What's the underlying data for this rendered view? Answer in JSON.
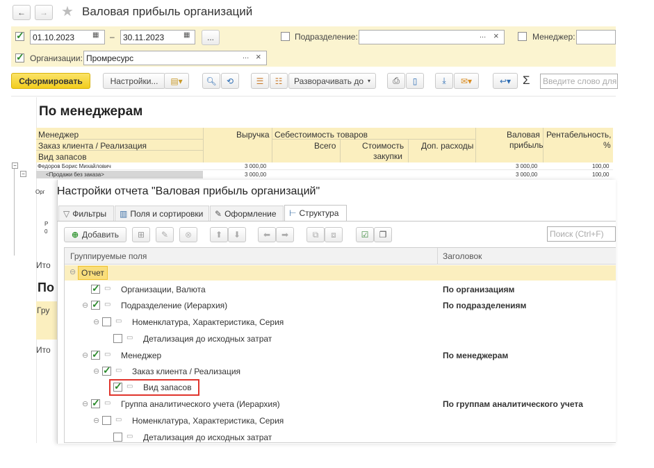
{
  "window": {
    "title": "Валовая прибыль организаций"
  },
  "filters": {
    "date_from": "01.10.2023",
    "date_dash": "–",
    "date_to": "30.11.2023",
    "dots": "...",
    "division_label": "Подразделение:",
    "manager_label": "Менеджер:",
    "org_label": "Организации:",
    "org_value": "Промресурс",
    "clear": "×"
  },
  "toolbar": {
    "generate": "Сформировать",
    "settings": "Настройки...",
    "expand": "Разворачивать до",
    "search_placeholder": "Введите слово для"
  },
  "report": {
    "title": "По менеджерам",
    "headers": {
      "manager": "Менеджер",
      "order": "Заказ клиента / Реализация",
      "stock_type": "Вид запасов",
      "revenue": "Выручка",
      "cost_group": "Себестоимость товаров",
      "total": "Всего",
      "cost_value": "Стоимость",
      "purchases": "закупки",
      "extra": "Доп. расходы",
      "gross": "Валовая",
      "profit": "прибыль",
      "margin": "Рентабельность,",
      "percent": "%"
    },
    "rows": [
      {
        "name": "Федоров Борис Михайлович",
        "revenue": "3 000,00",
        "gross": "3 000,00",
        "margin": "100,00"
      },
      {
        "name": "<Продажи без заказа>",
        "revenue": "3 000,00",
        "gross": "3 000,00",
        "margin": "100,00"
      }
    ],
    "bg_itog1": "Ито",
    "bg_itog2": "Ито",
    "bg_po": "По",
    "bg_gru": "Гру",
    "bg_org": "Орг",
    "bg_r": "Р",
    "bg_0": "0"
  },
  "dialog": {
    "title": "Настройки отчета \"Валовая прибыль организаций\"",
    "tabs": [
      "Фильтры",
      "Поля и сортировки",
      "Оформление",
      "Структура"
    ],
    "add": "Добавить",
    "search_placeholder": "Поиск (Ctrl+F)",
    "col_fields": "Группируемые поля",
    "col_header": "Заголовок",
    "tree": [
      {
        "label": "Отчет",
        "header": ""
      },
      {
        "label": "Организации, Валюта",
        "header": "По организациям"
      },
      {
        "label": "Подразделение (Иерархия)",
        "header": "По подразделениям"
      },
      {
        "label": "Номенклатура, Характеристика, Серия",
        "header": ""
      },
      {
        "label": "Детализация до исходных затрат",
        "header": ""
      },
      {
        "label": "Менеджер",
        "header": "По менеджерам"
      },
      {
        "label": "Заказ клиента / Реализация",
        "header": ""
      },
      {
        "label": "Вид запасов",
        "header": ""
      },
      {
        "label": "Группа аналитического учета (Иерархия)",
        "header": "По группам аналитического учета"
      },
      {
        "label": "Номенклатура, Характеристика, Серия",
        "header": ""
      },
      {
        "label": "Детализация до исходных затрат",
        "header": ""
      }
    ]
  },
  "colors": {
    "filter_bg": "#fbf4d0",
    "accent_yellow": "#f5d52f",
    "header_band": "#fbefbf",
    "highlight_red": "#e0342c"
  }
}
